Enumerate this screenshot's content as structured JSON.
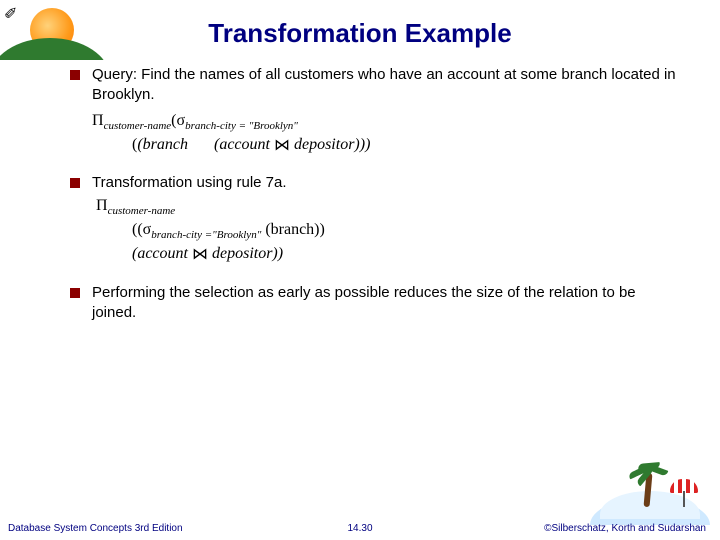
{
  "title": "Transformation Example",
  "bullets": {
    "b1": {
      "text": "Query:  Find the names of all customers who have an account at some branch located in Brooklyn.",
      "expr1_prefix": "Π",
      "expr1_sub": "customer-name",
      "expr1_open": "(σ",
      "expr1_sigma_sub": "branch-city = \"Brooklyn\"",
      "expr1_line2_a": "(branch",
      "expr1_line2_b": "(account",
      "expr1_line2_c": "depositor)))"
    },
    "b2": {
      "text": "Transformation using rule 7a.",
      "expr_prefix": "Π",
      "expr_sub": "customer-name",
      "expr_line2_a": "((σ",
      "expr_line2_sub": "branch-city =\"Brooklyn\"",
      "expr_line2_b": " (branch))",
      "expr_line3_a": "(account",
      "expr_line3_b": "depositor))"
    },
    "b3": {
      "text": "Performing the selection as early as possible reduces the size of the relation to be joined."
    }
  },
  "footer": {
    "left": "Database System Concepts 3rd Edition",
    "center": "14.30",
    "right": "©Silberschatz, Korth and Sudarshan"
  },
  "glyphs": {
    "join": "⋈"
  }
}
